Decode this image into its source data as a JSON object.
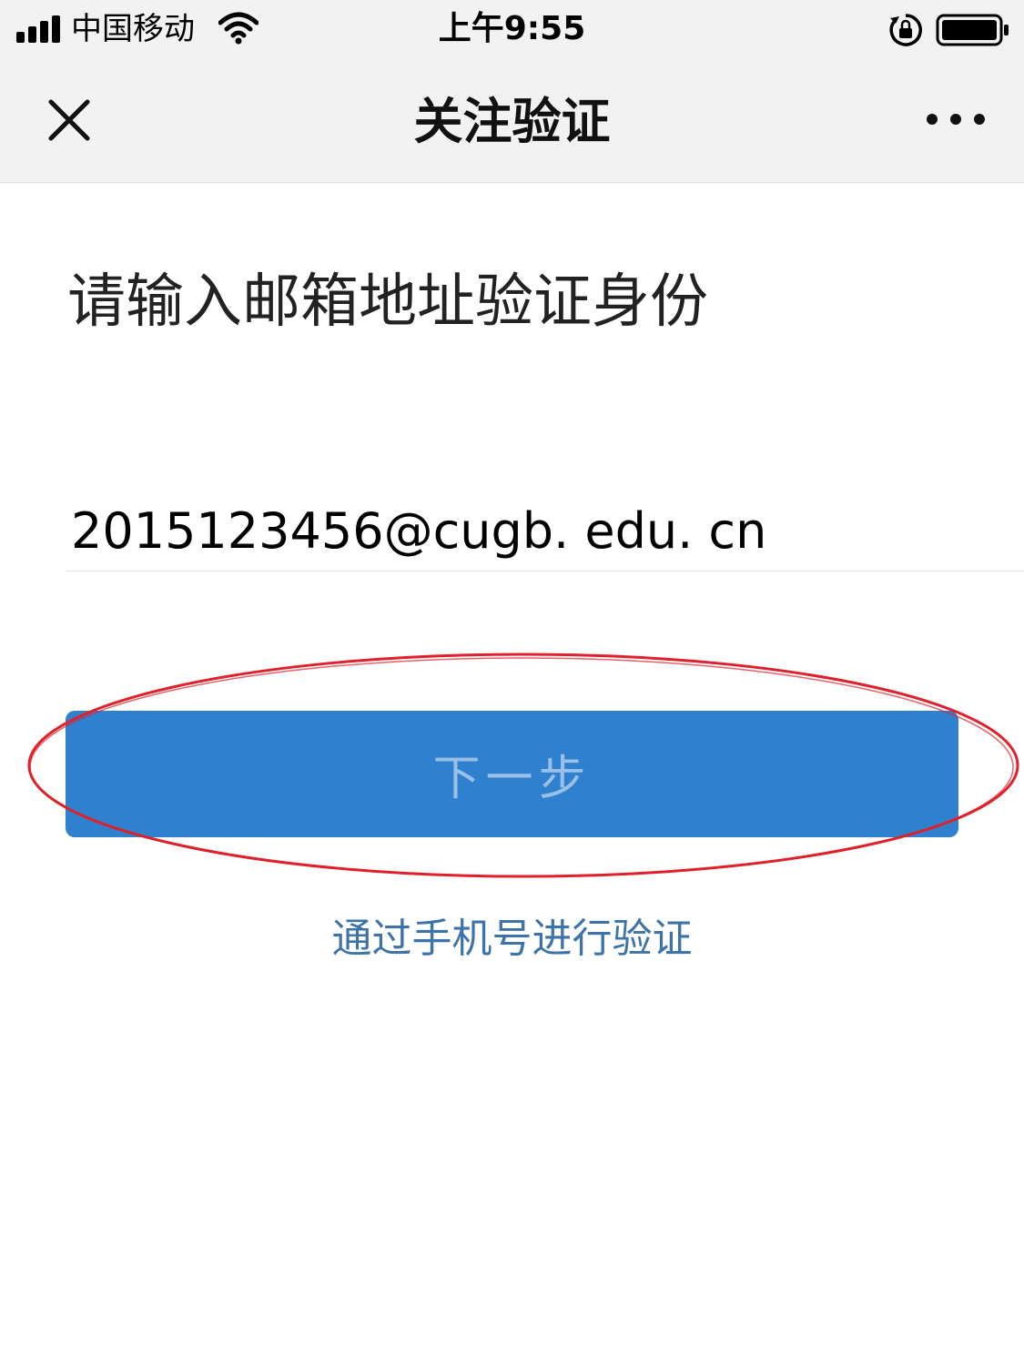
{
  "status_bar": {
    "carrier": "中国移动",
    "time": "上午9:55",
    "icons": [
      "signal-icon",
      "wifi-icon",
      "rotation-lock-icon",
      "battery-icon"
    ]
  },
  "nav": {
    "title": "关注验证",
    "close_icon": "close-icon",
    "more_icon": "more-icon"
  },
  "form": {
    "prompt": "请输入邮箱地址验证身份",
    "email_value": "2015123456@cugb. edu. cn",
    "next_label": "下一步",
    "alt_link": "通过手机号进行验证"
  },
  "colors": {
    "primary_button": "#3080d0",
    "button_text": "#9bc0e8",
    "link": "#3d73a8",
    "annotation": "#e0202a",
    "bar_background": "#f2f2f2"
  }
}
